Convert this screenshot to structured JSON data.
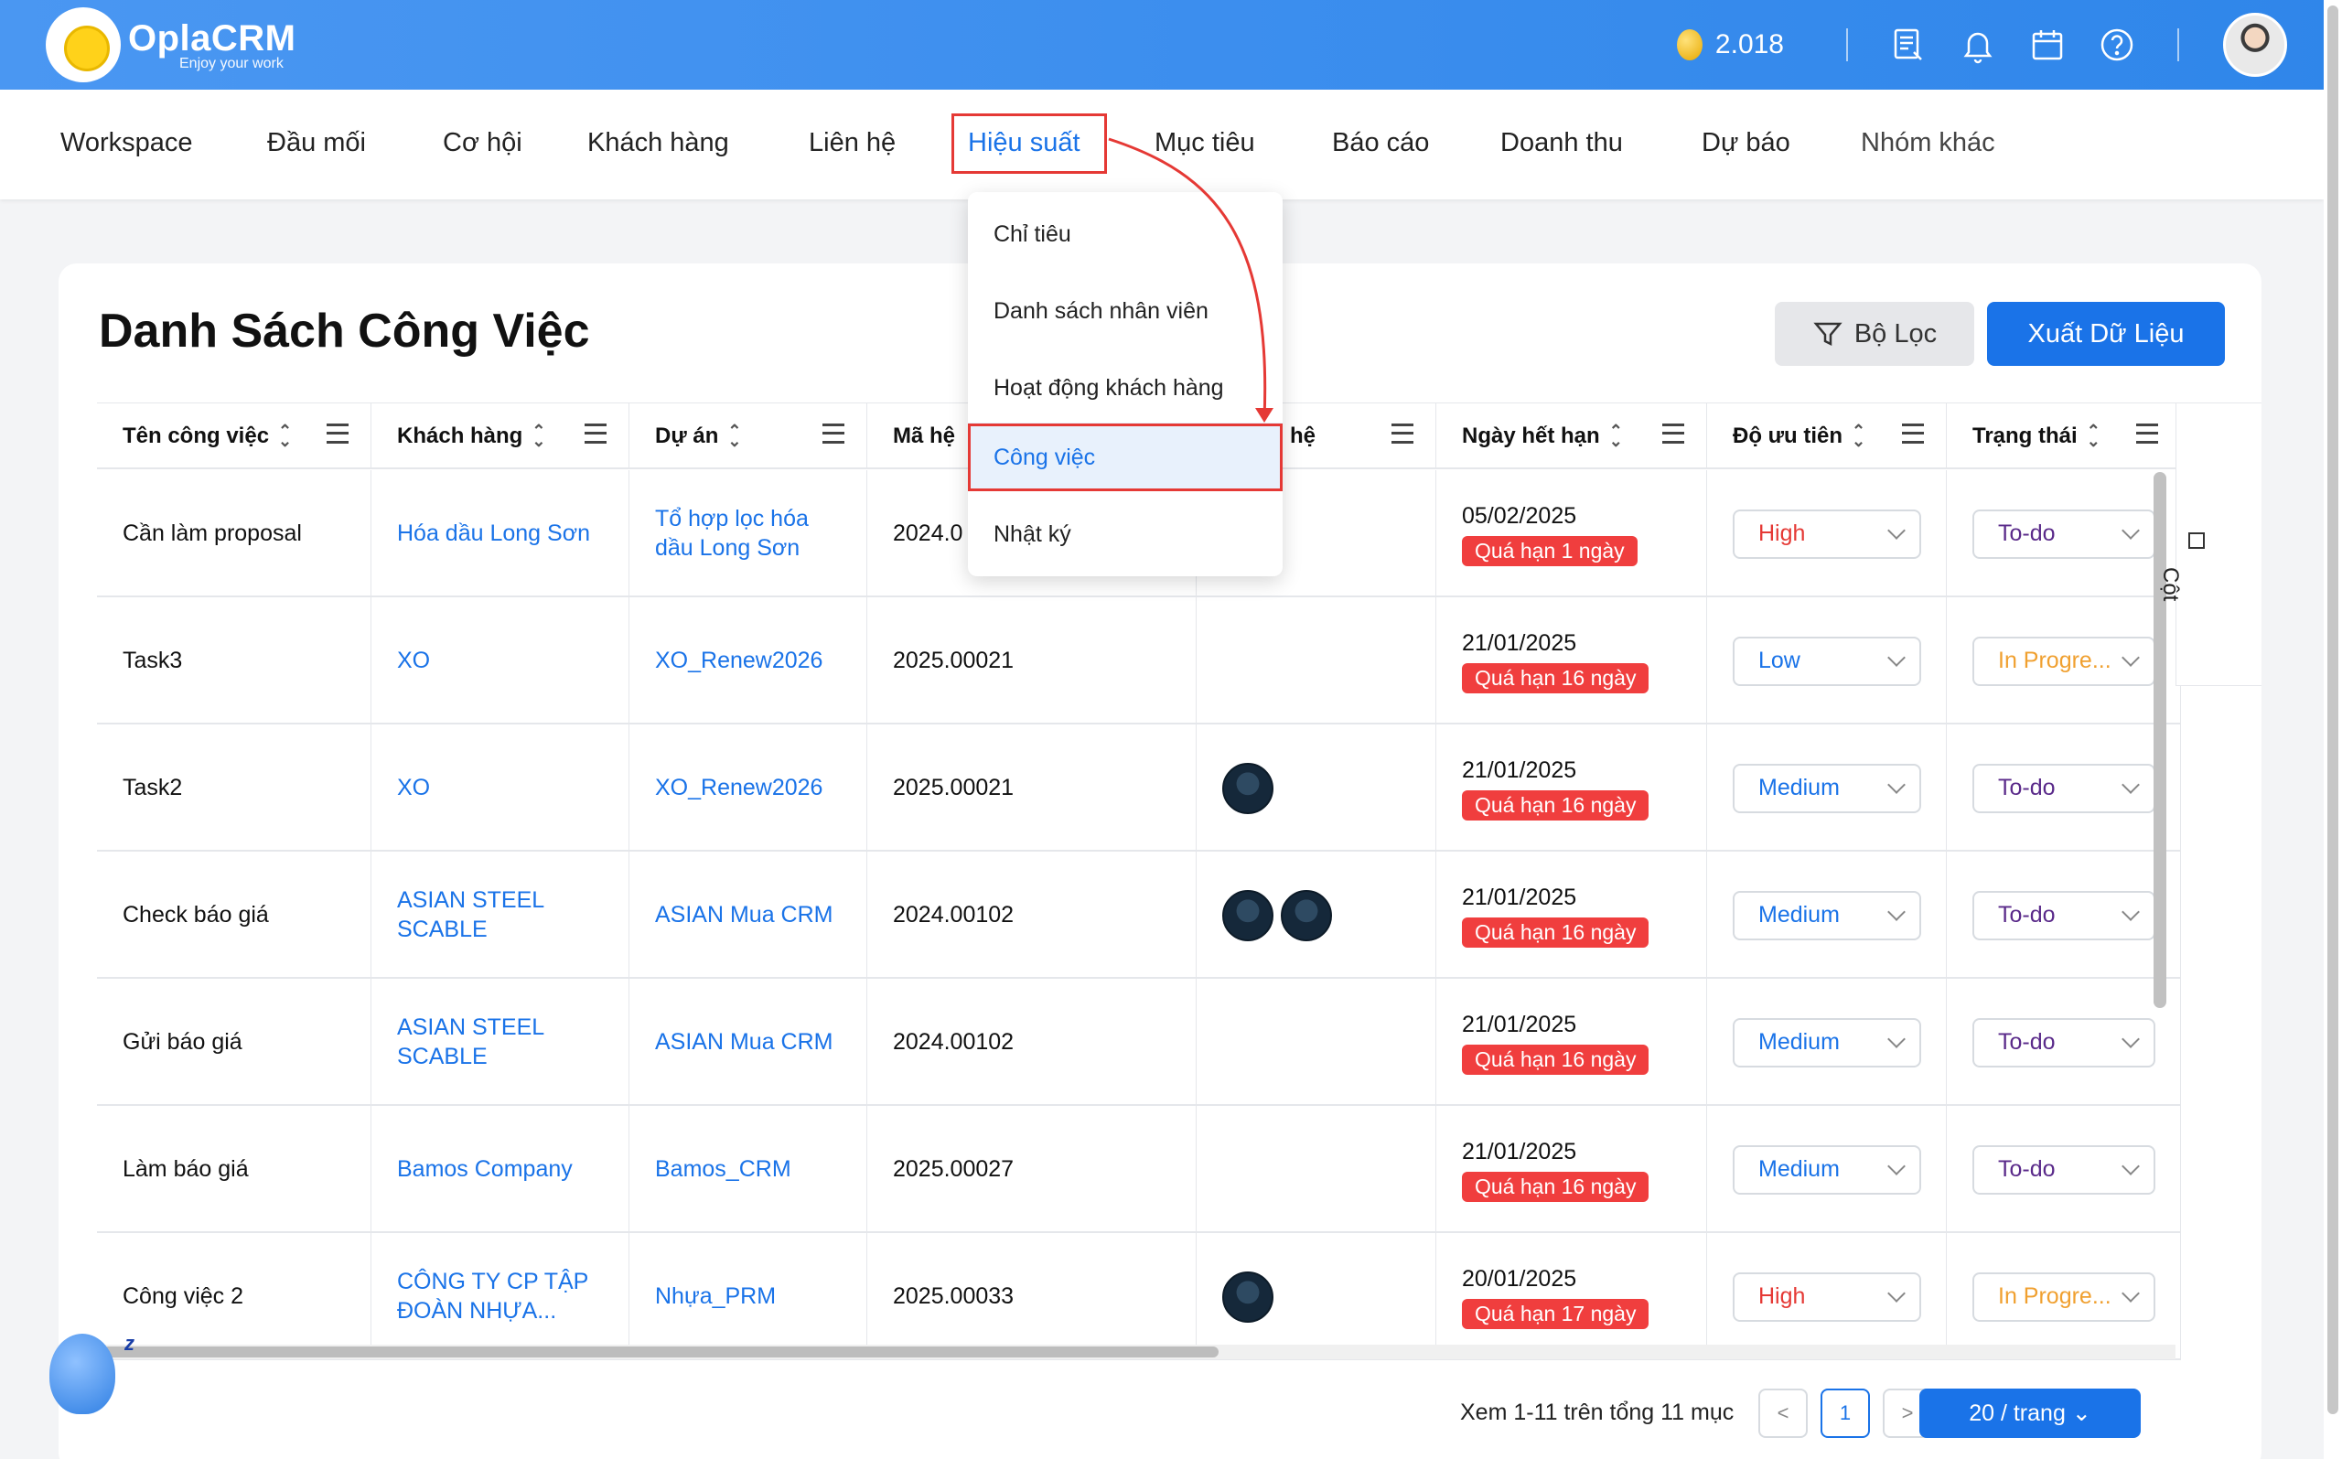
{
  "header": {
    "brand": "OplaCRM",
    "tagline": "Enjoy your work",
    "coins": "2.018",
    "icons": [
      "report-icon",
      "bell-icon",
      "calendar-icon",
      "help-icon"
    ]
  },
  "nav": {
    "items": [
      "Workspace",
      "Đầu mối",
      "Cơ hội",
      "Khách hàng",
      "Liên hệ",
      "Hiệu suất",
      "Mục tiêu",
      "Báo cáo",
      "Doanh thu",
      "Dự báo",
      "Nhóm khác"
    ],
    "active": "Hiệu suất"
  },
  "dropdown": {
    "items": [
      "Chỉ tiêu",
      "Danh sách nhân viên",
      "Hoạt động khách hàng",
      "Công việc",
      "Nhật ký"
    ],
    "selected": "Công việc"
  },
  "page": {
    "title": "Danh Sách Công Việc",
    "filter_label": "Bộ Lọc",
    "export_label": "Xuất Dữ Liệu",
    "columns_label": "Cột"
  },
  "table": {
    "headers": [
      "Tên công việc",
      "Khách hàng",
      "Dự án",
      "Mã hệ",
      "hệ",
      "Ngày hết hạn",
      "Độ ưu tiên",
      "Trạng thái"
    ],
    "rows": [
      {
        "name": "Cần làm proposal",
        "customer": "Hóa dầu Long Sơn",
        "project": "Tổ hợp lọc hóa dầu Long Sơn",
        "code": "2024.0",
        "assignees": 0,
        "due": "05/02/2025",
        "overdue": "Quá hạn 1 ngày",
        "priority": "High",
        "status": "To-do"
      },
      {
        "name": "Task3",
        "customer": "XO",
        "project": "XO_Renew2026",
        "code": "2025.00021",
        "assignees": 0,
        "due": "21/01/2025",
        "overdue": "Quá hạn 16 ngày",
        "priority": "Low",
        "status": "In Progre..."
      },
      {
        "name": "Task2",
        "customer": "XO",
        "project": "XO_Renew2026",
        "code": "2025.00021",
        "assignees": 1,
        "due": "21/01/2025",
        "overdue": "Quá hạn 16 ngày",
        "priority": "Medium",
        "status": "To-do"
      },
      {
        "name": "Check báo giá",
        "customer": "ASIAN STEEL SCABLE",
        "project": "ASIAN Mua CRM",
        "code": "2024.00102",
        "assignees": 2,
        "due": "21/01/2025",
        "overdue": "Quá hạn 16 ngày",
        "priority": "Medium",
        "status": "To-do"
      },
      {
        "name": "Gửi báo giá",
        "customer": "ASIAN STEEL SCABLE",
        "project": "ASIAN Mua CRM",
        "code": "2024.00102",
        "assignees": 0,
        "due": "21/01/2025",
        "overdue": "Quá hạn 16 ngày",
        "priority": "Medium",
        "status": "To-do"
      },
      {
        "name": "Làm báo giá",
        "customer": "Bamos Company",
        "project": "Bamos_CRM",
        "code": "2025.00027",
        "assignees": 0,
        "due": "21/01/2025",
        "overdue": "Quá hạn 16 ngày",
        "priority": "Medium",
        "status": "To-do"
      },
      {
        "name": "Công việc 2",
        "customer": "CÔNG TY CP TẬP ĐOÀN NHỰA...",
        "project": "Nhựa_PRM",
        "code": "2025.00033",
        "assignees": 1,
        "due": "20/01/2025",
        "overdue": "Quá hạn 17 ngày",
        "priority": "High",
        "status": "In Progre..."
      }
    ]
  },
  "pagination": {
    "summary": "Xem 1-11 trên tổng 11 mục",
    "prev": "<",
    "current": "1",
    "next": ">",
    "page_size": "20 / trang"
  },
  "colors": {
    "primary": "#1a73e8",
    "header": "#3a8cee",
    "danger": "#f03e3e",
    "highlight_box": "#e53935"
  }
}
